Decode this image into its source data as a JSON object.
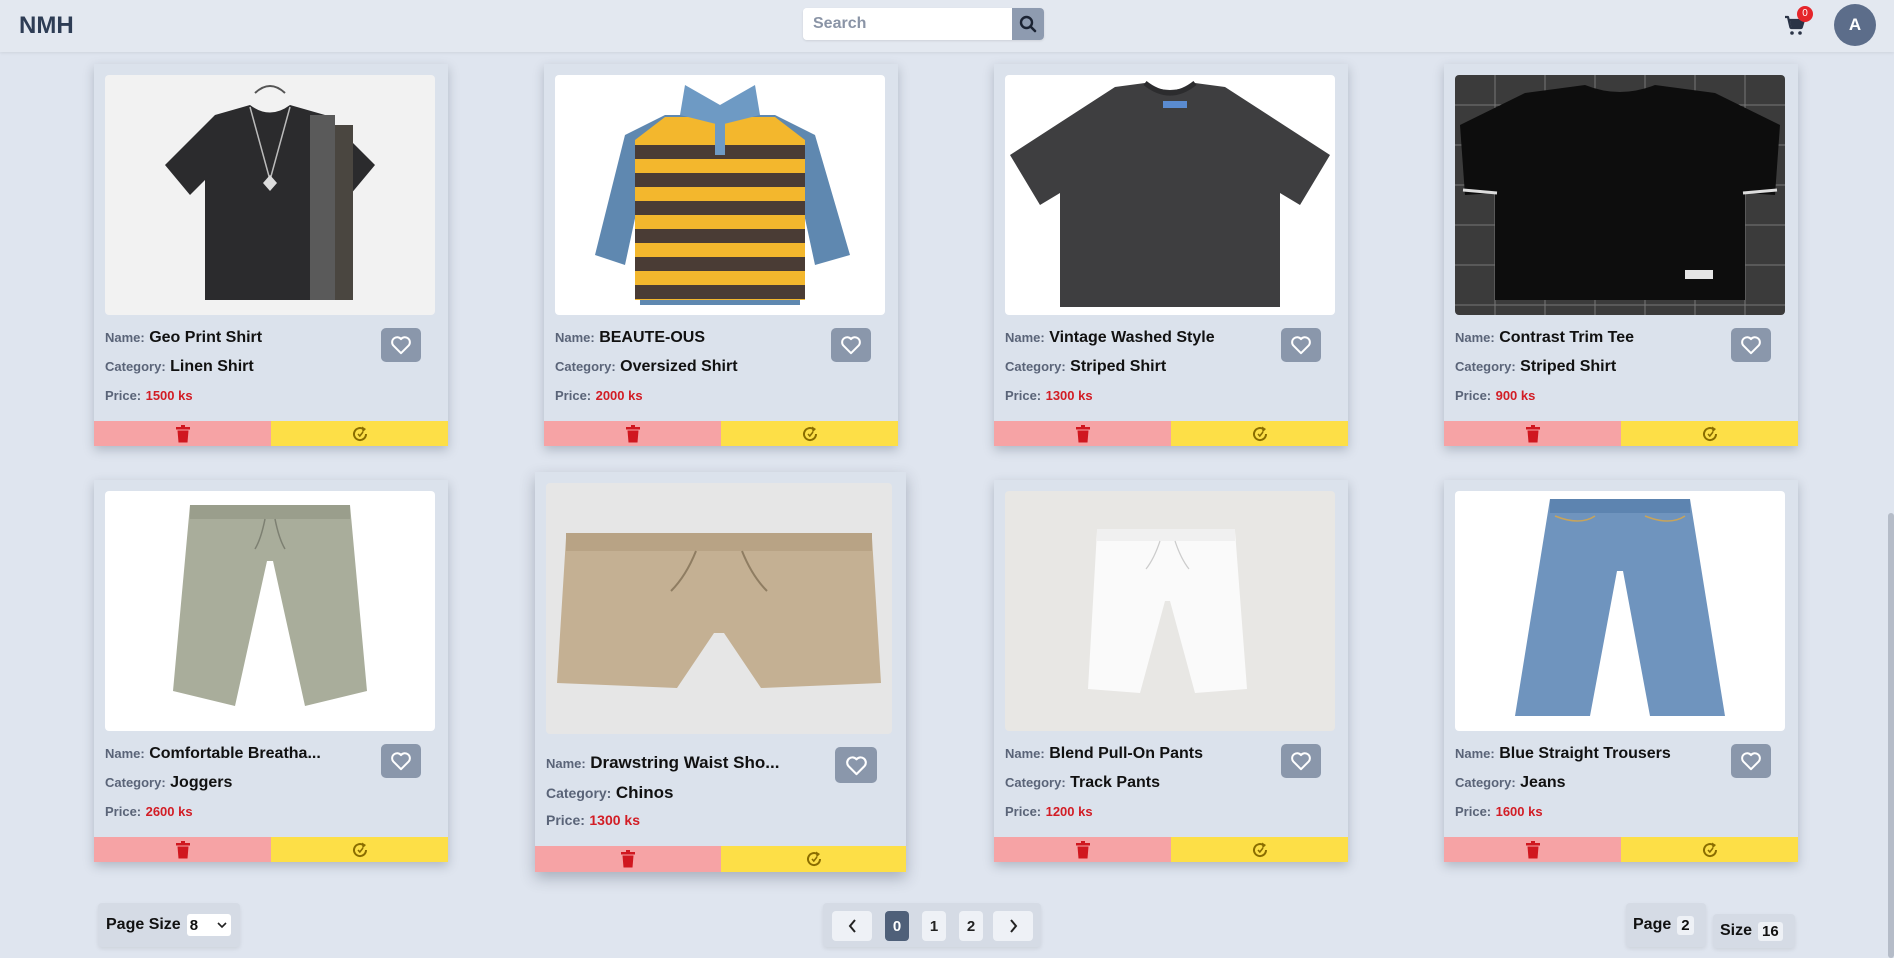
{
  "header": {
    "brand": "NMH",
    "search_placeholder": "Search",
    "cart_count": "0",
    "avatar_initial": "A"
  },
  "labels": {
    "name": "Name:",
    "category": "Category:",
    "price": "Price:"
  },
  "products": [
    {
      "name": "Geo Print Shirt",
      "category": "Linen Shirt",
      "price": "1500 ks",
      "image": "black t-shirt with geometric side panel on hanger"
    },
    {
      "name": "BEAUTE-OUS",
      "category": "Oversized Shirt",
      "price": "2000 ks",
      "image": "yellow and brown striped polo with denim sleeves"
    },
    {
      "name": "Vintage Washed Style",
      "category": "Striped Shirt",
      "price": "1300 ks",
      "image": "charcoal washed t-shirt"
    },
    {
      "name": "Contrast Trim Tee",
      "category": "Striped Shirt",
      "price": "900 ks",
      "image": "black tee with white trim on tiled wall"
    },
    {
      "name": "Comfortable Breatha...",
      "category": "Joggers",
      "price": "2600 ks",
      "image": "sage linen cropped pants"
    },
    {
      "name": "Drawstring Waist Sho...",
      "category": "Chinos",
      "price": "1300 ks",
      "image": "khaki drawstring shorts"
    },
    {
      "name": "Blend Pull-On Pants",
      "category": "Track Pants",
      "price": "1200 ks",
      "image": "white pull-on shorts"
    },
    {
      "name": "Blue Straight Trousers",
      "category": "Jeans",
      "price": "1600 ks",
      "image": "blue denim cropped jeans"
    }
  ],
  "footer": {
    "page_size_label": "Page Size",
    "page_size_value": "8",
    "pages": [
      "0",
      "1",
      "2"
    ],
    "active_page": "0",
    "page_label": "Page",
    "page_value": "2",
    "size_label": "Size",
    "size_value": "16"
  },
  "colors": {
    "delete": "#f6a3a5",
    "update": "#fddf47",
    "price": "#d21d25",
    "accent": "#4f6079"
  }
}
